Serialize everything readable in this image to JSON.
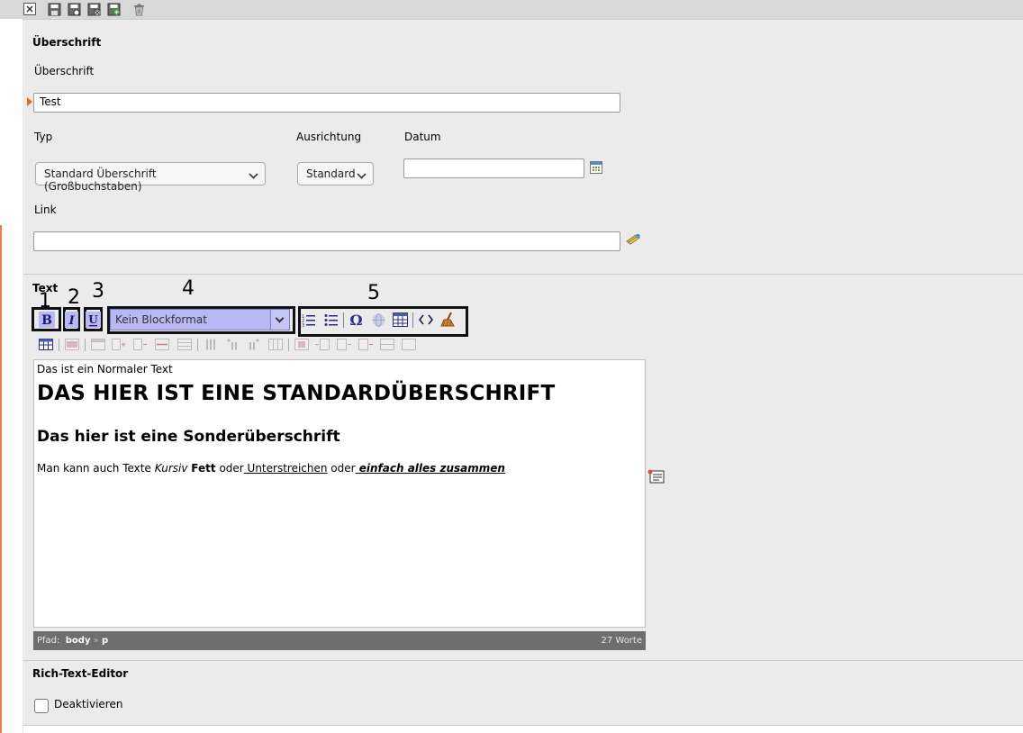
{
  "toolbar": {
    "icons": [
      "close-icon",
      "save-icon",
      "save-view-icon",
      "save-close-icon",
      "save-new-icon",
      "delete-icon"
    ]
  },
  "heading_section": {
    "title": "Überschrift",
    "field_label": "Überschrift",
    "field_value": "Test",
    "type_label": "Typ",
    "type_value": "Standard Überschrift (Großbuchstaben)",
    "align_label": "Ausrichtung",
    "align_value": "Standard",
    "date_label": "Datum",
    "date_value": "",
    "link_label": "Link",
    "link_value": ""
  },
  "text_section": {
    "title": "Text",
    "annotations": [
      "1",
      "2",
      "3",
      "4",
      "5"
    ],
    "blockformat": "Kein Blockformat",
    "editor": {
      "paragraph1": "Das ist ein Normaler Text",
      "heading1": "DAS HIER IST EINE STANDARDÜBERSCHRIFT",
      "heading2": "Das hier ist eine Sonderüberschrift",
      "p2_a": "Man kann auch Texte ",
      "p2_italic": "Kursiv",
      "p2_b": " ",
      "p2_bold": "Fett",
      "p2_c": " oder",
      "p2_underline": " Unterstreichen",
      "p2_d": " oder",
      "p2_all": " einfach alles zusammen"
    },
    "status": {
      "path_label": "Pfad:",
      "path_body": "body",
      "path_sep": "»",
      "path_p": "p",
      "word_count": "27 Worte"
    }
  },
  "rte_section": {
    "title": "Rich-Text-Editor",
    "checkbox_label": "Deaktivieren",
    "checked": false
  }
}
